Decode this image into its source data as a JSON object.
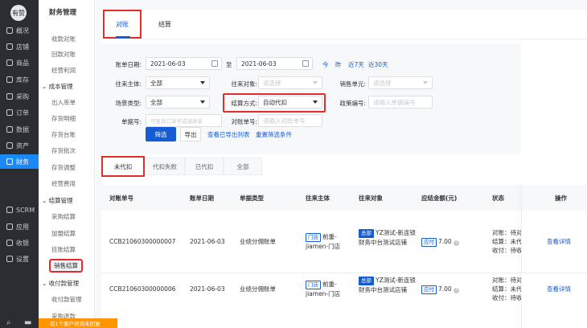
{
  "nav": {
    "avatar": "有赞",
    "items": [
      "概况",
      "店铺",
      "商品",
      "库存",
      "采购",
      "订单",
      "数据",
      "资产",
      "财务"
    ],
    "active_index": 8,
    "bottom_items": [
      "SCRM",
      "应用",
      "收银",
      "设置"
    ]
  },
  "submenu": {
    "title": "财务管理",
    "items_top": [
      "收款对账",
      "回款对账",
      "经营利润"
    ],
    "group_cost": "成本管理",
    "cost_items": [
      "出入库单",
      "存货明细",
      "存货台账",
      "存货批次",
      "存货调整",
      "经营费用"
    ],
    "group_settle": "结算管理",
    "settle_items": [
      "采购结算",
      "加盟结算",
      "挂账结算",
      "销售结算"
    ],
    "group_pay": "收付款管理",
    "pay_items": [
      "收付款管理",
      "采购退款"
    ]
  },
  "tabs_top": [
    "对账",
    "结算"
  ],
  "filter": {
    "date_label": "账单日期:",
    "date_from": "2021-06-03",
    "date_to_sep": "至",
    "date_to": "2021-06-03",
    "quick": [
      "今",
      "昨",
      "近7天",
      "近30天"
    ],
    "subject_label": "往来主体:",
    "subject_value": "全部",
    "object_label": "往来对象:",
    "object_ph": "请选择",
    "unit_label": "销售单元:",
    "unit_ph": "请选择",
    "scene_label": "场景类型:",
    "scene_value": "全部",
    "method_label": "结算方式:",
    "method_value": "自动代扣",
    "policy_label": "政策编号:",
    "policy_ph": "请输入单据编号",
    "doc_label": "单据号:",
    "doc_ph": "可查询订单号或退款单",
    "bill_label": "对账单号:",
    "bill_ph": "请输入对账单号",
    "search_btn": "筛选",
    "export_btn": "导出",
    "view_export": "查看已导出列表",
    "reset": "重置筛选条件"
  },
  "tabs2": [
    "未代扣",
    "代扣失败",
    "已代扣",
    "全部"
  ],
  "table": {
    "headers": [
      "对账单号",
      "账单日期",
      "单据类型",
      "往来主体",
      "往来对象",
      "应结金额(元)",
      "状态",
      "操作"
    ],
    "rows": [
      {
        "no": "CCB21060300000007",
        "date": "2021-06-03",
        "type": "业绩分佣账单",
        "subject_tag": "门店",
        "subject_name": "前重-jiamen-门店",
        "object_tag": "总部",
        "object_name": "YZ测试-新连锁财务中台测试店铺",
        "amount_tag": "应付",
        "amount": "7.00",
        "status": [
          "对账：待对",
          "结算：未代",
          "收付：待收"
        ],
        "action": "查看详情"
      },
      {
        "no": "CCB21060300000006",
        "date": "2021-06-03",
        "type": "业绩分佣账单",
        "subject_tag": "门店",
        "subject_name": "前重-jiamen-门店",
        "object_tag": "总部",
        "object_name": "YZ测试-新连锁财务中台测试店铺",
        "amount_tag": "应付",
        "amount": "7.00",
        "status": [
          "对账：待对",
          "结算：未代",
          "收付：待收"
        ],
        "action": "查看详情"
      }
    ]
  },
  "notice": "有1个客户咨询未回复"
}
